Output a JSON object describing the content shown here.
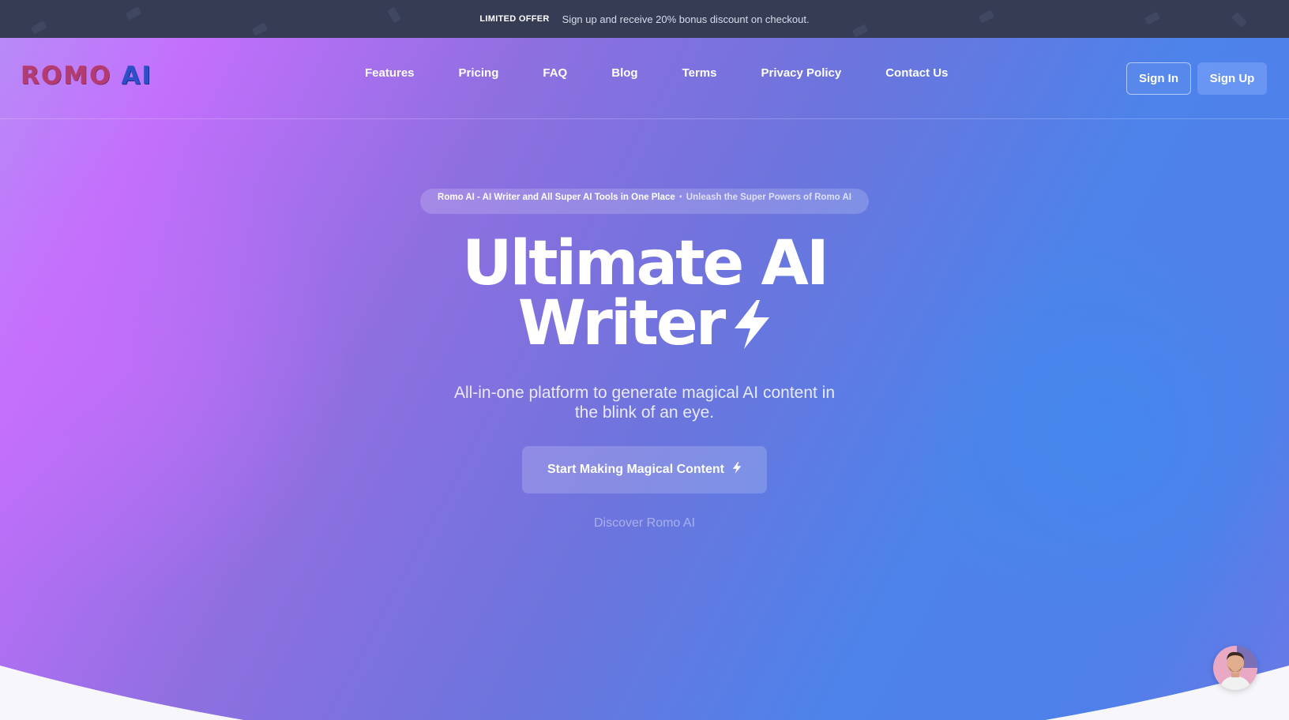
{
  "promo": {
    "tag": "LIMITED OFFER",
    "text": "Sign up and receive 20% bonus discount on checkout."
  },
  "brand": {
    "logo_part1": "ROMO",
    "logo_part2": "AI"
  },
  "nav": {
    "links": [
      "Features",
      "Pricing",
      "FAQ",
      "Blog",
      "Terms",
      "Privacy Policy",
      "Contact Us"
    ],
    "signin_label": "Sign In",
    "signup_label": "Sign Up"
  },
  "hero": {
    "badge_main": "Romo AI - AI Writer and All Super AI Tools in One Place",
    "badge_sub": "Unleash the Super Powers of Romo AI",
    "title_line1": "Ultimate AI",
    "title_line2": "Writer",
    "subtitle": "All-in-one platform to generate magical AI content in the blink of an eye.",
    "cta_label": "Start Making Magical Content",
    "discover_label": "Discover Romo AI"
  },
  "icons": {
    "headline_icon": "lightning-bolt-icon",
    "cta_icon": "lightning-bolt-icon",
    "chat_avatar": "support-avatar"
  },
  "colors": {
    "topbar_bg": "#353c54",
    "gradient_purple": "#c36ffd",
    "gradient_blue": "#4d83ea",
    "page_bg": "#f7f7fb"
  }
}
